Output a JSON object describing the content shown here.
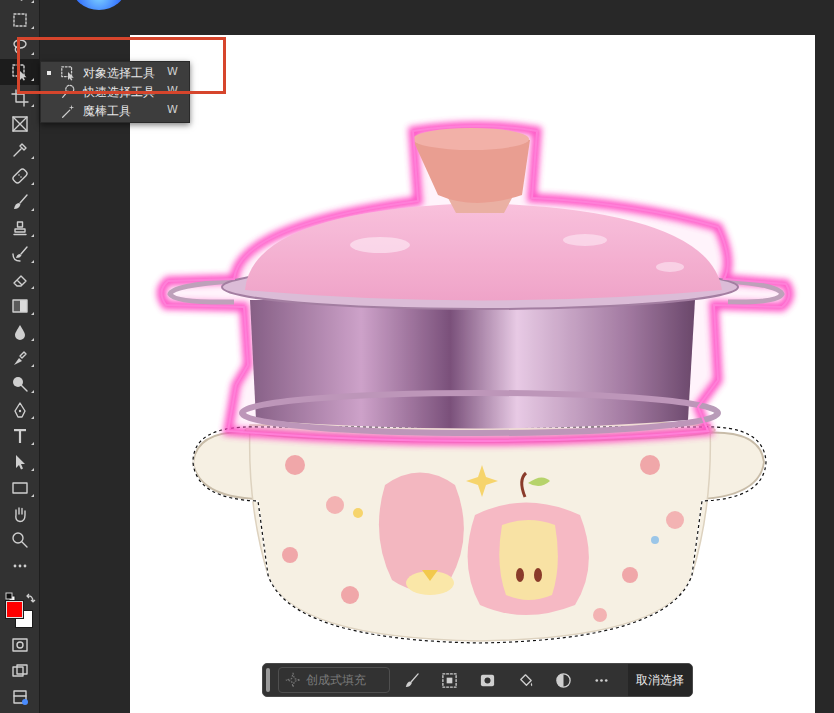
{
  "toolbar": {
    "tools": [
      {
        "selected": false
      },
      {
        "selected": false
      },
      {
        "selected": false
      },
      {
        "selected": true
      },
      {
        "selected": false
      },
      {
        "selected": false
      },
      {
        "selected": false
      },
      {
        "selected": false
      },
      {
        "selected": false
      },
      {
        "selected": false
      },
      {
        "selected": false
      },
      {
        "selected": false
      },
      {
        "selected": false
      },
      {
        "selected": false
      },
      {
        "selected": false
      },
      {
        "selected": false
      },
      {
        "selected": false
      },
      {
        "selected": false
      },
      {
        "selected": false
      },
      {
        "selected": false
      },
      {
        "selected": false
      },
      {
        "selected": false
      },
      {
        "selected": false
      }
    ]
  },
  "colors": {
    "foreground": "#ff0000",
    "background": "#ffffff"
  },
  "flyout": {
    "items": [
      {
        "label": "对象选择工具",
        "shortcut": "W",
        "selected": true
      },
      {
        "label": "快速选择工具",
        "shortcut": "W",
        "selected": false
      },
      {
        "label": "魔棒工具",
        "shortcut": "W",
        "selected": false
      }
    ]
  },
  "taskbar": {
    "generative_fill": {
      "label": "创成式填充",
      "disabled": true
    },
    "deselect": {
      "label": "取消选择"
    }
  }
}
